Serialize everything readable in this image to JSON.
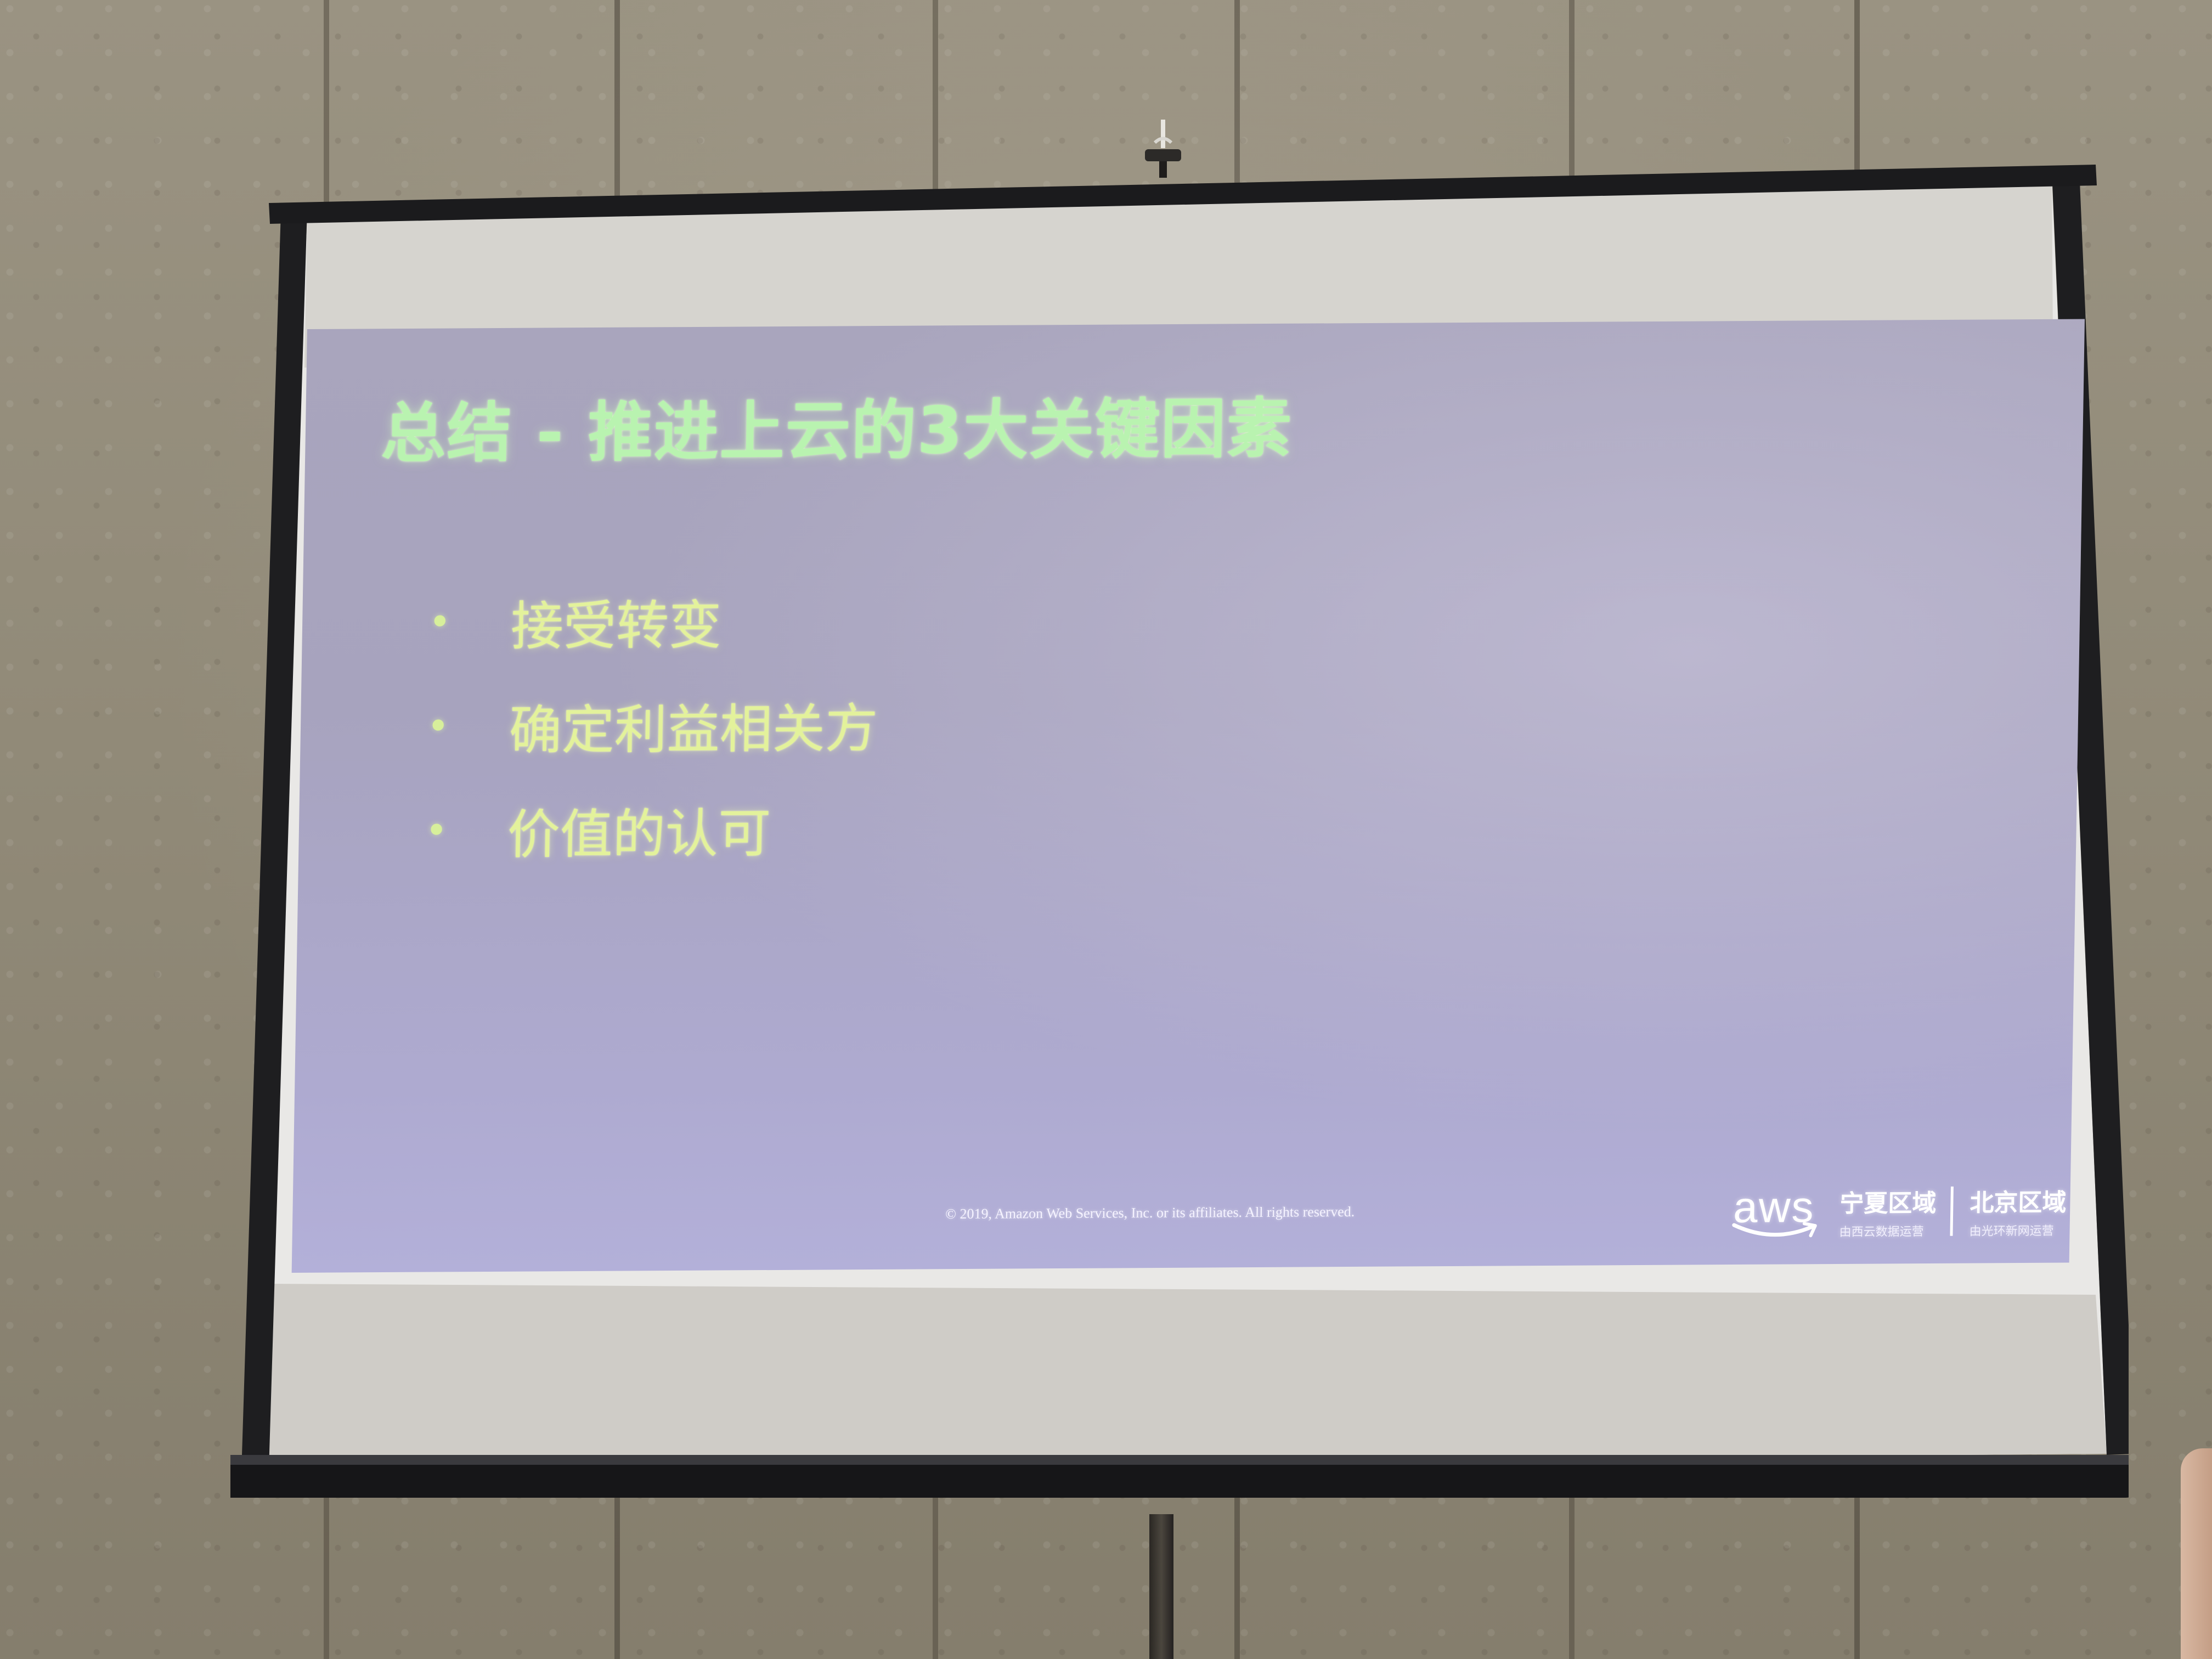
{
  "slide": {
    "title": "总结 - 推进上云的3大关键因素",
    "bullets": [
      "接受转变",
      "确定利益相关方",
      "价值的认可"
    ],
    "bullet_symbol": "•",
    "copyright": "© 2019, Amazon Web Services, Inc. or its affiliates. All rights reserved.",
    "logo": {
      "brand": "aws",
      "regions": [
        {
          "name": "宁夏区域",
          "partner": "由西云数据运营"
        },
        {
          "name": "北京区域",
          "partner": "由光环新网运营"
        }
      ]
    }
  },
  "colors": {
    "title": "#b9f3b0",
    "bullet_text": "#e3f29b",
    "slide_background": "#a9a5bd",
    "screen_white": "#e9e8e6",
    "frame": "#1b1b1d",
    "wall": "#918a78"
  }
}
